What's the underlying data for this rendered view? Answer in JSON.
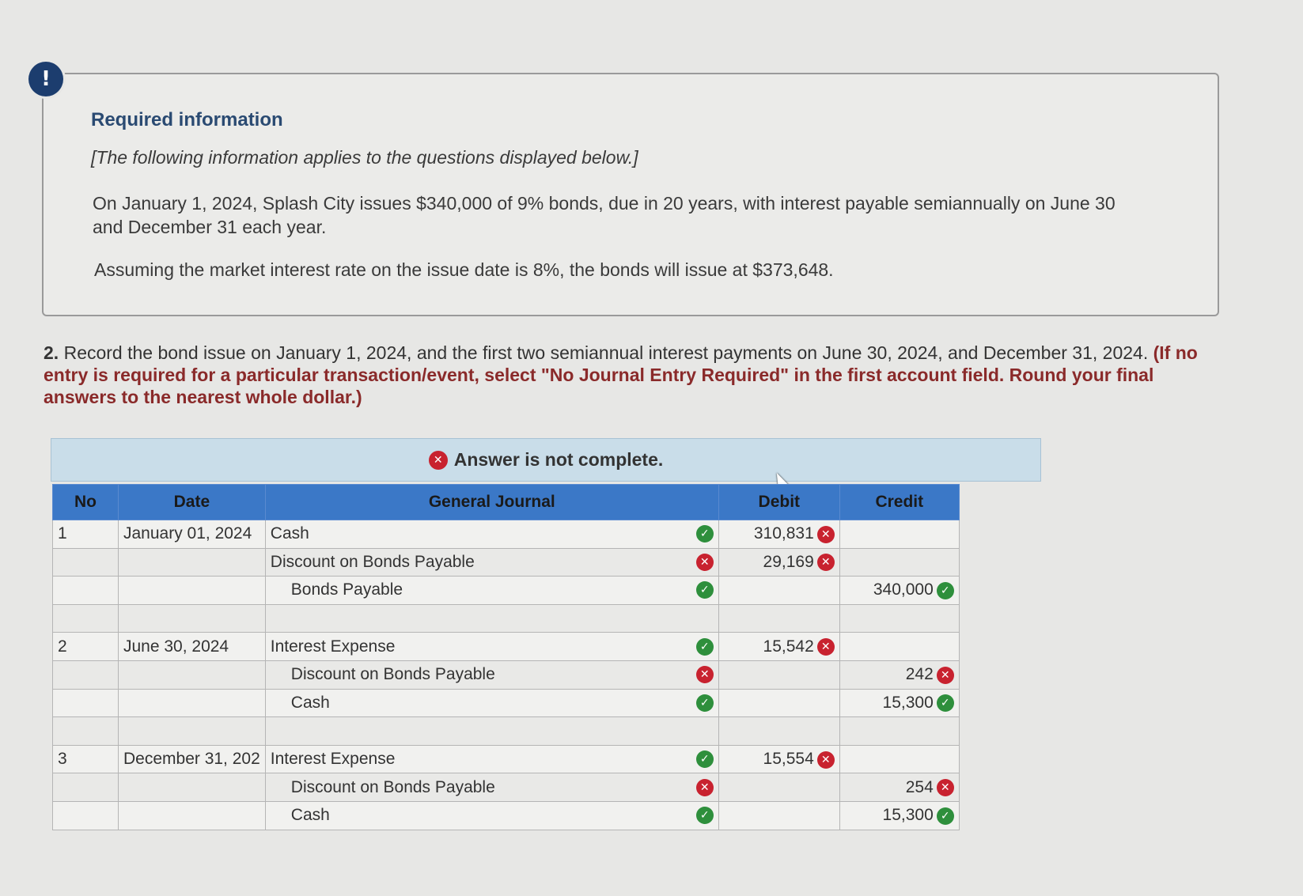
{
  "info": {
    "title": "Required information",
    "subtitle": "[The following information applies to the questions displayed below.]",
    "paragraph1": "On January 1, 2024, Splash City issues $340,000 of 9% bonds, due in 20 years, with interest payable semiannually on June 30 and December 31 each year.",
    "paragraph2": "Assuming the market interest rate on the issue date is 8%, the bonds will issue at $373,648."
  },
  "question": {
    "number": "2.",
    "text": "Record the bond issue on January 1, 2024, and the first two semiannual interest payments on June 30, 2024, and December 31, 2024.",
    "note": "(If no entry is required for a particular transaction/event, select \"No Journal Entry Required\" in the first account field. Round your final answers to the nearest whole dollar.)"
  },
  "banner": {
    "text": "Answer is not complete."
  },
  "table": {
    "headers": {
      "no": "No",
      "date": "Date",
      "journal": "General Journal",
      "debit": "Debit",
      "credit": "Credit"
    },
    "rows": [
      {
        "no": "1",
        "date": "January 01, 2024",
        "account": "Cash",
        "indent": false,
        "acct_status": "ok",
        "debit": "310,831",
        "debit_status": "x",
        "credit": "",
        "credit_status": ""
      },
      {
        "no": "",
        "date": "",
        "account": "Discount on Bonds Payable",
        "indent": false,
        "acct_status": "x",
        "debit": "29,169",
        "debit_status": "x",
        "credit": "",
        "credit_status": ""
      },
      {
        "no": "",
        "date": "",
        "account": "Bonds Payable",
        "indent": true,
        "acct_status": "ok",
        "debit": "",
        "debit_status": "",
        "credit": "340,000",
        "credit_status": "ok"
      },
      {
        "no": "",
        "date": "",
        "account": "",
        "indent": false,
        "acct_status": "",
        "debit": "",
        "debit_status": "",
        "credit": "",
        "credit_status": ""
      },
      {
        "no": "2",
        "date": "June 30, 2024",
        "account": "Interest Expense",
        "indent": false,
        "acct_status": "ok",
        "debit": "15,542",
        "debit_status": "x",
        "credit": "",
        "credit_status": ""
      },
      {
        "no": "",
        "date": "",
        "account": "Discount on Bonds Payable",
        "indent": true,
        "acct_status": "x",
        "debit": "",
        "debit_status": "",
        "credit": "242",
        "credit_status": "x"
      },
      {
        "no": "",
        "date": "",
        "account": "Cash",
        "indent": true,
        "acct_status": "ok",
        "debit": "",
        "debit_status": "",
        "credit": "15,300",
        "credit_status": "ok"
      },
      {
        "no": "",
        "date": "",
        "account": "",
        "indent": false,
        "acct_status": "",
        "debit": "",
        "debit_status": "",
        "credit": "",
        "credit_status": ""
      },
      {
        "no": "3",
        "date": "December 31, 202",
        "account": "Interest Expense",
        "indent": false,
        "acct_status": "ok",
        "debit": "15,554",
        "debit_status": "x",
        "credit": "",
        "credit_status": ""
      },
      {
        "no": "",
        "date": "",
        "account": "Discount on Bonds Payable",
        "indent": true,
        "acct_status": "x",
        "debit": "",
        "debit_status": "",
        "credit": "254",
        "credit_status": "x"
      },
      {
        "no": "",
        "date": "",
        "account": "Cash",
        "indent": true,
        "acct_status": "ok",
        "debit": "",
        "debit_status": "",
        "credit": "15,300",
        "credit_status": "ok"
      }
    ]
  },
  "colors": {
    "header_blue": "#3b78c7",
    "banner_bg": "#c9dde9",
    "error_red": "#c8222f",
    "ok_green": "#2e8f3c",
    "alert_navy": "#1c3d6e"
  }
}
